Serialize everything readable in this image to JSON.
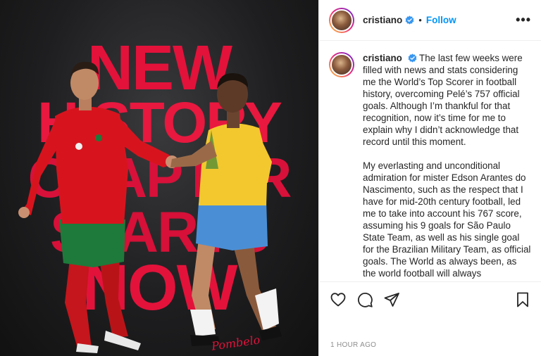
{
  "post": {
    "headline_lines": [
      "NEW",
      "HISTORY",
      "CHAPTER",
      "STARTS",
      "NOW"
    ],
    "signature": "Pombelo"
  },
  "header": {
    "username": "cristiano",
    "separator": "•",
    "follow_label": "Follow",
    "more_label": "•••"
  },
  "caption": {
    "username": "cristiano",
    "paragraph_1": "The last few weeks were filled with news and stats considering me the World’s Top Scorer in football history, overcoming Pelé’s 757 official goals. Although I’m thankful for that recognition, now it’s time for me to explain why I didn’t acknowledge that record until this moment.",
    "paragraph_2": "My everlasting and unconditional admiration for mister Edson Arantes do Nascimento, such as the respect that I have for mid-20th century football, led me to take into account his 767 score, assuming his 9 goals for São Paulo State Team, as well as his single goal for the Brazilian Military Team, as official goals. The World as always been, as the world football will always"
  },
  "actions": {
    "like_icon": "heart-icon",
    "comment_icon": "comment-icon",
    "share_icon": "paper-plane-icon",
    "save_icon": "bookmark-icon"
  },
  "timestamp": "1 HOUR AGO",
  "colors": {
    "accent": "#0095f6",
    "headline_red": "#e3123b",
    "muted": "#8e8e8e"
  }
}
